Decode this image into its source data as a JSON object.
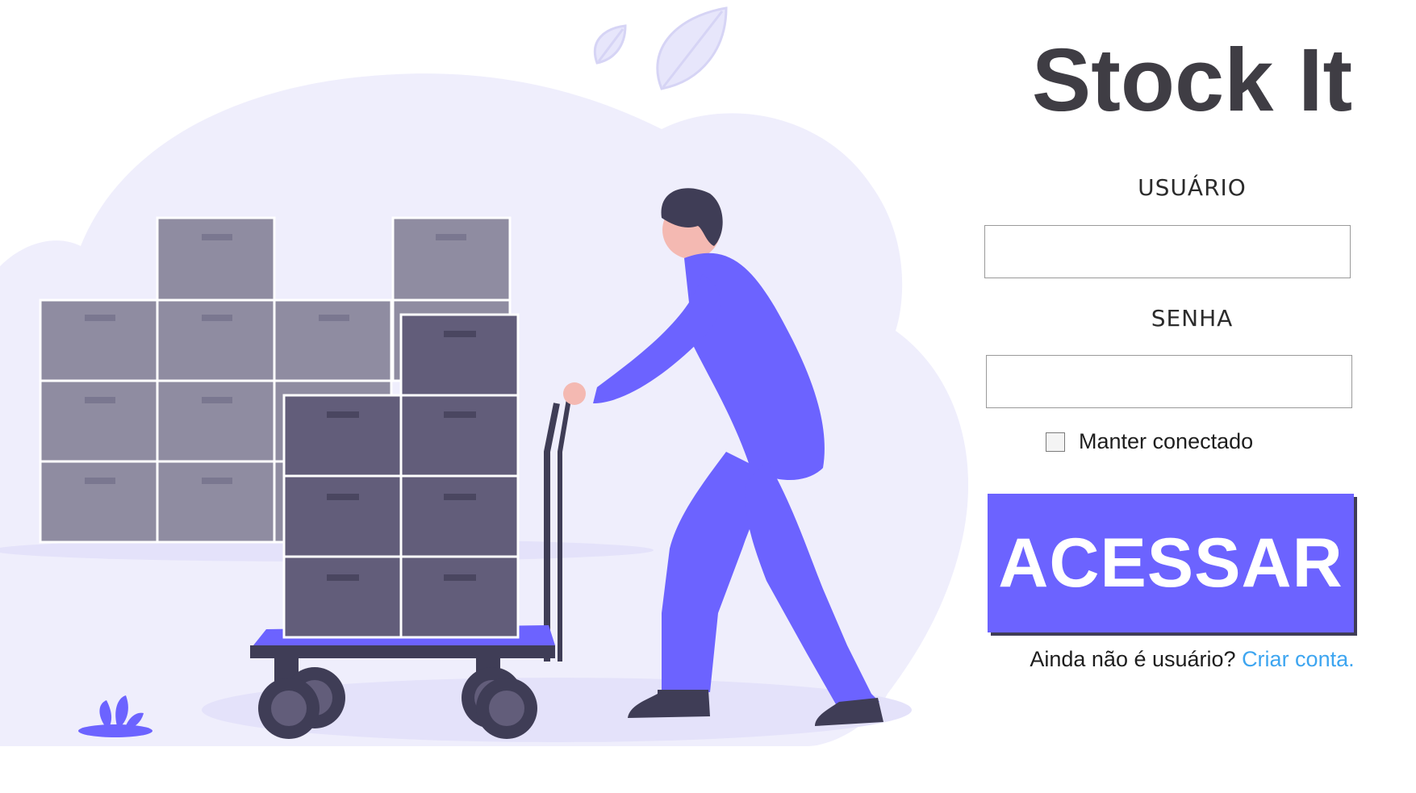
{
  "app": {
    "title": "Stock It"
  },
  "login_form": {
    "username_label": "USUÁRIO",
    "username_value": "",
    "password_label": "SENHA",
    "password_value": "",
    "remember_label": "Manter conectado",
    "remember_checked": false,
    "submit_label": "ACESSAR",
    "signup_prompt": "Ainda não é usuário?",
    "signup_link": "Criar conta."
  },
  "illustration": {
    "subject": "worker-pushing-hand-truck-with-boxes",
    "accent_color": "#6c63ff",
    "dark_color": "#3f3d56",
    "box_color": "#8f8ca1",
    "background_blob_color": "#efeefc"
  },
  "colors": {
    "title": "#3f3d44",
    "button": "#6c63ff",
    "button_text": "#ffffff",
    "link": "#3da5f0"
  }
}
